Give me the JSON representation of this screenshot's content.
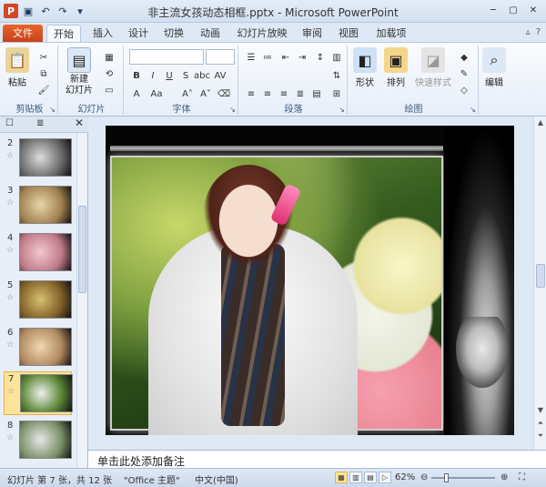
{
  "window": {
    "title": "非主流女孩动态相框.pptx - Microsoft PowerPoint",
    "app_icon": "P"
  },
  "ribbon_tabs": [
    "开始",
    "插入",
    "设计",
    "切换",
    "动画",
    "幻灯片放映",
    "审阅",
    "视图",
    "加载项"
  ],
  "file_tab": "文件",
  "groups": {
    "clipboard": {
      "label": "剪贴板",
      "paste": "粘贴"
    },
    "slides": {
      "label": "幻灯片",
      "new_slide": "新建\n幻灯片"
    },
    "font": {
      "label": "字体"
    },
    "paragraph": {
      "label": "段落"
    },
    "drawing": {
      "label": "绘图",
      "shapes": "形状",
      "arrange": "排列",
      "quick_styles": "快速样式"
    },
    "editing": {
      "label": "编辑"
    }
  },
  "slides_pane": {
    "slides": [
      {
        "num": "2"
      },
      {
        "num": "3"
      },
      {
        "num": "4"
      },
      {
        "num": "5"
      },
      {
        "num": "6"
      },
      {
        "num": "7",
        "selected": true
      },
      {
        "num": "8"
      }
    ]
  },
  "notes": {
    "placeholder": "单击此处添加备注"
  },
  "status": {
    "slide_info": "幻灯片 第 7 张，共 12 张",
    "theme": "\"Office 主题\"",
    "language": "中文(中国)",
    "zoom": "62%"
  },
  "colors": {
    "accent": "#2b579a",
    "file_tab": "#d24726",
    "selected_slide": "#fce49a"
  }
}
